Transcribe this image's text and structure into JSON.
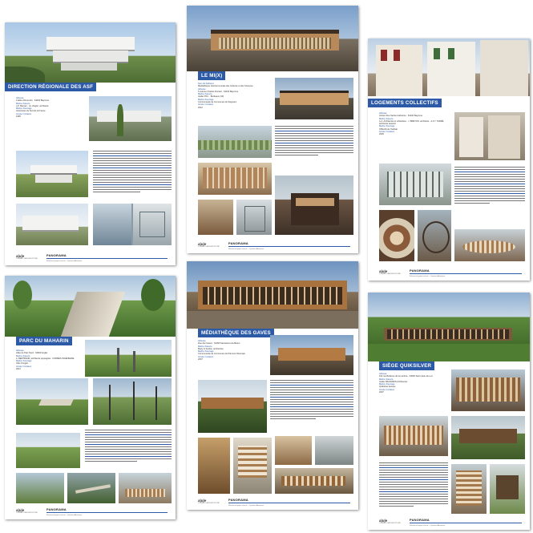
{
  "pages": [
    {
      "title": "DIRECTION RÉGIONALE DES ASF",
      "meta": [
        {
          "k": "Adresse",
          "v": "3 allée Abreuvoirs · 64000 Bayonne"
        },
        {
          "k": "Maître d’œuvre",
          "v": "J-P. Marsan · Ja. Ziegler, architecte"
        },
        {
          "k": "Maître d’ouvrage",
          "v": "Autoroutes du Sud de la France"
        },
        {
          "k": "Année / livraison",
          "v": "1995"
        }
      ]
    },
    {
      "title": "LE MI(X)",
      "meta": [
        {
          "k": "Nom du bâtiment",
          "v": "Médiathèque Intercommunale des Cultures et des Sciences"
        },
        {
          "k": "Adresse",
          "v": "6 avenue Charles Flocard · 64100 Bayonne"
        },
        {
          "k": "Maître d’œuvre",
          "v": "Atelier Phil… Bordeaux (33)"
        },
        {
          "k": "Maître d’ouvrage",
          "v": "Communauté de Communes de Seignanx"
        },
        {
          "k": "Année / livraison",
          "v": "2012"
        }
      ]
    },
    {
      "title": "LOGEMENTS COLLECTIFS",
      "meta": [
        {
          "k": "Adresse",
          "v": "Ancien Rue Sainte-Catherine · 64100 Bayonne"
        },
        {
          "k": "Maître d’œuvre",
          "v": "A.A. Architectes et urbanistes · J. BRETON, architecte · A.F.Y. TARRÉ, architecte associé"
        },
        {
          "k": "Maître d’ouvrage",
          "v": "Office64 de l’habitat"
        },
        {
          "k": "Année / livraison",
          "v": "2009"
        }
      ]
    },
    {
      "title": "PARC DU MAHARIN",
      "meta": [
        {
          "k": "Adresse",
          "v": "Allée du Parc Nord · 64600 Anglet"
        },
        {
          "k": "Maître d’œuvre",
          "v": "A. BERTRAND, architecte paysagiste · FORMES INGÉNIERIE"
        },
        {
          "k": "Maître d’ouvrage",
          "v": "Ville d’Anglet"
        },
        {
          "k": "Année / livraison",
          "v": "2012"
        }
      ]
    },
    {
      "title": "MÉDIATHÈQUE DES GAVES",
      "meta": [
        {
          "k": "Adresse",
          "v": "Rue des Gaves · 64390 Sauveterre-de-Béarn"
        },
        {
          "k": "Maître d’œuvre",
          "v": "Marty & Soubie, architectes"
        },
        {
          "k": "Maître d’ouvrage",
          "v": "Communauté de Communes du Piémont Oloronais"
        },
        {
          "k": "Année / livraison",
          "v": "2007"
        }
      ]
    },
    {
      "title": "SIÈGE QUIKSILVER",
      "meta": [
        {
          "k": "Adresse",
          "v": "162 rue Bellevue de la Lambra · 64600 Saint-Jean-de-Luz"
        },
        {
          "k": "Maître d’œuvre",
          "v": "Atelier BAUMARIN Architectes"
        },
        {
          "k": "Maître d’ouvrage",
          "v": "Quiksilver Europe"
        },
        {
          "k": "Année / livraison",
          "v": "2007"
        }
      ]
    }
  ],
  "footer": {
    "logo_text": "a|u|e",
    "logo_sub": "CONSEIL D'ARCHITECTURE",
    "panorama": "PANORAMA",
    "note": "Sélection de projets récents — Pyrénées-Atlantiques"
  }
}
